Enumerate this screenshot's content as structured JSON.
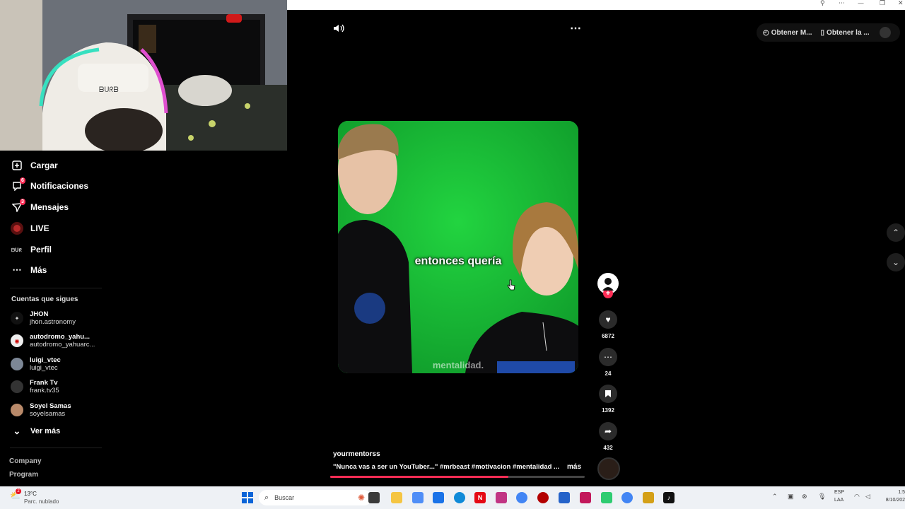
{
  "browser": {
    "window_controls": [
      "⚲",
      "⋯",
      "—",
      "❐",
      "✕"
    ]
  },
  "sidebar": {
    "items": [
      {
        "label": "Cargar",
        "icon": "upload-icon"
      },
      {
        "label": "Notificaciones",
        "icon": "inbox-icon",
        "badge": "6"
      },
      {
        "label": "Mensajes",
        "icon": "send-icon",
        "badge": "3"
      },
      {
        "label": "LIVE",
        "icon": "live-icon"
      },
      {
        "label": "Perfil",
        "icon": "profile-icon"
      },
      {
        "label": "Más",
        "icon": "more-icon"
      }
    ],
    "following_title": "Cuentas que sigues",
    "following": [
      {
        "name": "JHON",
        "handle": "jhon.astronomy"
      },
      {
        "name": "autodromo_yahu...",
        "handle": "autodromo_yahuarc..."
      },
      {
        "name": "luigi_vtec",
        "handle": "luigi_vtec"
      },
      {
        "name": "Frank Tv",
        "handle": "frank.tv35"
      },
      {
        "name": "Soyel Samas",
        "handle": "soyelsamas"
      }
    ],
    "see_more": "Ver más",
    "footer": [
      "Company",
      "Program"
    ]
  },
  "video": {
    "caption": "entonces quería",
    "watermark": "mentalidad.",
    "author": "yourmentorss",
    "description": "\"Nunca vas a ser un YouTuber...\" #mrbeast #motivacion #mentalidad ...",
    "more": "más",
    "progress": 0.7
  },
  "actions": {
    "likes": "6872",
    "comments": "24",
    "saves": "1392",
    "shares": "432"
  },
  "header_right": {
    "get_app_1": "Obtener M...",
    "get_app_2": "Obtener la ..."
  },
  "taskbar": {
    "weather_temp": "13°C",
    "weather_desc": "Parc. nublado",
    "search_placeholder": "Buscar",
    "lang": "ESP",
    "lang_sub": "LAA",
    "time": "1:5",
    "date": "8/10/202"
  },
  "colors": {
    "accent": "#fe2c55",
    "green_screen": "#17c436"
  }
}
